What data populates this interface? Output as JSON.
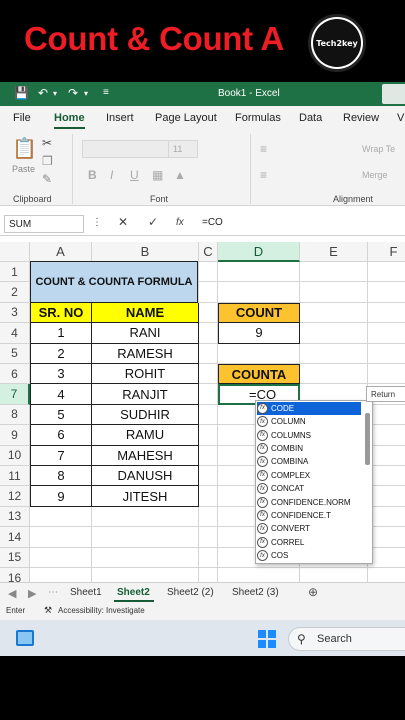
{
  "banner": {
    "title": "Count & Count A",
    "logo_text": "Tech2key"
  },
  "titlebar": {
    "document": "Book1 - Excel"
  },
  "ribbon_tabs": [
    "File",
    "Home",
    "Insert",
    "Page Layout",
    "Formulas",
    "Data",
    "Review",
    "V"
  ],
  "ribbon": {
    "paste_label": "Paste",
    "clipboard_label": "Clipboard",
    "font_label": "Font",
    "font_size": "11",
    "wrap_label": "Wrap Te",
    "merge_label": "Merge",
    "alignment_label": "Alignment"
  },
  "formula_bar": {
    "name_box": "SUM",
    "fx": "fx",
    "formula": "=CO"
  },
  "columns": [
    "A",
    "B",
    "C",
    "D",
    "E",
    "F"
  ],
  "rows": [
    "1",
    "2",
    "3",
    "4",
    "5",
    "6",
    "7",
    "8",
    "9",
    "10",
    "11",
    "12",
    "13",
    "14",
    "15",
    "16"
  ],
  "sheet": {
    "title": "COUNT & COUNTA FORMULA",
    "headers": {
      "sr_no": "SR. NO",
      "name": "NAME"
    },
    "data": [
      {
        "sr": "1",
        "name": "RANI"
      },
      {
        "sr": "2",
        "name": "RAMESH"
      },
      {
        "sr": "3",
        "name": "ROHIT"
      },
      {
        "sr": "4",
        "name": "RANJIT"
      },
      {
        "sr": "5",
        "name": "SUDHIR"
      },
      {
        "sr": "6",
        "name": "RAMU"
      },
      {
        "sr": "7",
        "name": "MAHESH"
      },
      {
        "sr": "8",
        "name": "DANUSH"
      },
      {
        "sr": "9",
        "name": "JITESH"
      }
    ],
    "count_label": "COUNT",
    "count_value": "9",
    "counta_label": "COUNTA",
    "counta_input": "=CO"
  },
  "autocomplete": {
    "items": [
      "CODE",
      "COLUMN",
      "COLUMNS",
      "COMBIN",
      "COMBINA",
      "COMPLEX",
      "CONCAT",
      "CONFIDENCE.NORM",
      "CONFIDENCE.T",
      "CONVERT",
      "CORREL",
      "COS"
    ],
    "selected_index": 0,
    "tooltip": "Return"
  },
  "sheet_tabs": [
    "Sheet1",
    "Sheet2",
    "Sheet2 (2)",
    "Sheet2 (3)"
  ],
  "active_sheet": "Sheet2",
  "status": {
    "mode": "Enter",
    "accessibility": "Accessibility: Investigate"
  },
  "taskbar": {
    "search_placeholder": "Search"
  },
  "colors": {
    "excel_green": "#1e7145",
    "title_red": "#ee1c25",
    "yellow": "#ffff00",
    "orange": "#fdc32f",
    "blue": "#bdd7ee"
  }
}
